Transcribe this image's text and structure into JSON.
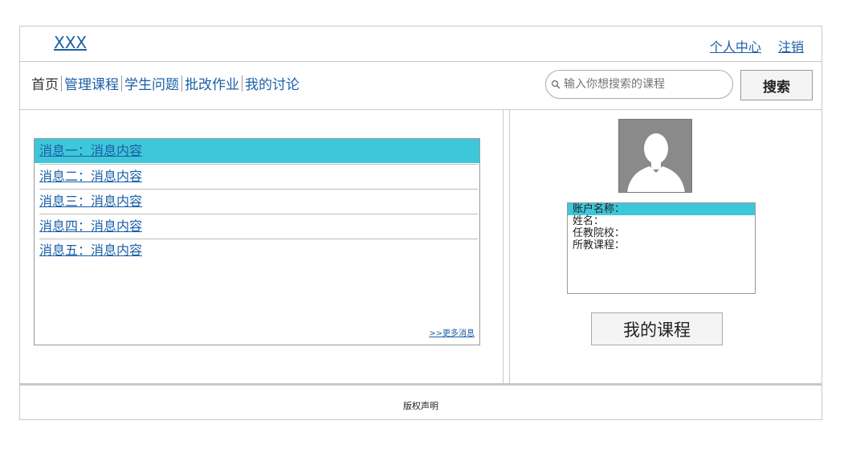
{
  "header": {
    "site_title": "XXX",
    "links": {
      "profile": "个人中心",
      "logout": "注销"
    }
  },
  "nav": {
    "items": [
      "首页",
      "管理课程",
      "学生问题",
      "批改作业",
      "我的讨论"
    ]
  },
  "search": {
    "placeholder": "输入你想搜索的课程",
    "button": "搜索"
  },
  "messages": {
    "items": [
      "消息一：消息内容",
      "消息二：消息内容",
      "消息三：消息内容",
      "消息四：消息内容",
      "消息五：消息内容"
    ],
    "more": ">>更多消息"
  },
  "profile": {
    "fields": [
      "账户名称：",
      "姓名：",
      "任教院校：",
      "所教课程："
    ],
    "button": "我的课程"
  },
  "footer": {
    "copyright": "版权声明"
  },
  "colors": {
    "accent": "#3ec6d9",
    "link": "#1a5fa8",
    "border": "#c8c8c8"
  },
  "icons": {
    "search": "magnifier-icon",
    "avatar": "person-silhouette-icon"
  }
}
